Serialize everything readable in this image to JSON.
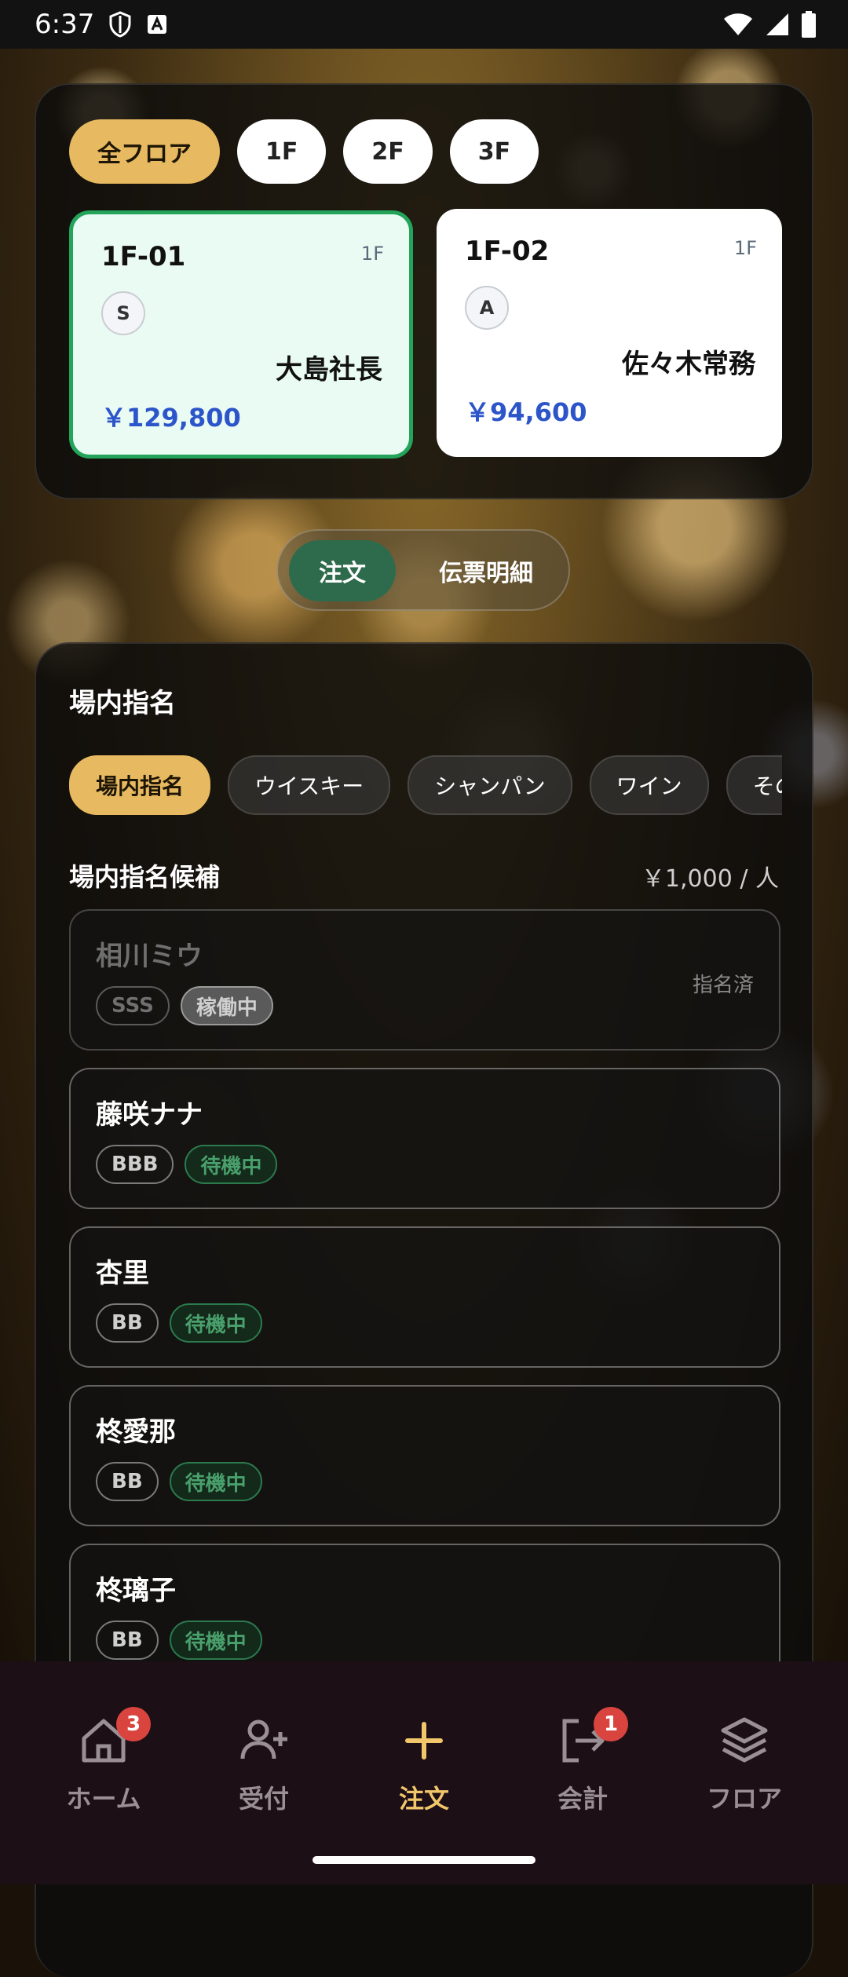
{
  "status_bar": {
    "time": "6:37"
  },
  "floor_filter": {
    "options": [
      "全フロア",
      "1F",
      "2F",
      "3F"
    ],
    "selected": "全フロア"
  },
  "tables": [
    {
      "name": "1F-01",
      "floor": "1F",
      "rank": "S",
      "guest": "大島社長",
      "amount": "￥129,800",
      "selected": true
    },
    {
      "name": "1F-02",
      "floor": "1F",
      "rank": "A",
      "guest": "佐々木常務",
      "amount": "￥94,600",
      "selected": false
    }
  ],
  "view_toggle": {
    "active": "注文",
    "other": "伝票明細"
  },
  "order": {
    "section_title": "場内指名",
    "categories": [
      "場内指名",
      "ウイスキー",
      "シャンパン",
      "ワイン",
      "その"
    ],
    "candidates_title": "場内指名候補",
    "price_per_person": "￥1,000 / 人",
    "casts": [
      {
        "name": "相川ミウ",
        "rank": "SSS",
        "status": "稼働中",
        "note": "指名済"
      },
      {
        "name": "藤咲ナナ",
        "rank": "BBB",
        "status": "待機中"
      },
      {
        "name": "杏里",
        "rank": "BB",
        "status": "待機中"
      },
      {
        "name": "柊愛那",
        "rank": "BB",
        "status": "待機中"
      },
      {
        "name": "柊璃子",
        "rank": "BB",
        "status": "待機中"
      }
    ]
  },
  "bottom_nav": {
    "items": [
      {
        "label": "ホーム",
        "icon": "home-icon",
        "badge": "3"
      },
      {
        "label": "受付",
        "icon": "add-user-icon"
      },
      {
        "label": "注文",
        "icon": "plus-icon",
        "active": true
      },
      {
        "label": "会計",
        "icon": "logout-icon",
        "badge": "1"
      },
      {
        "label": "フロア",
        "icon": "layers-icon"
      }
    ]
  },
  "colors": {
    "accent_gold": "#e7b960",
    "selected_green": "#23a45a",
    "price_blue": "#2b55c9",
    "badge_red": "#d9443f"
  }
}
